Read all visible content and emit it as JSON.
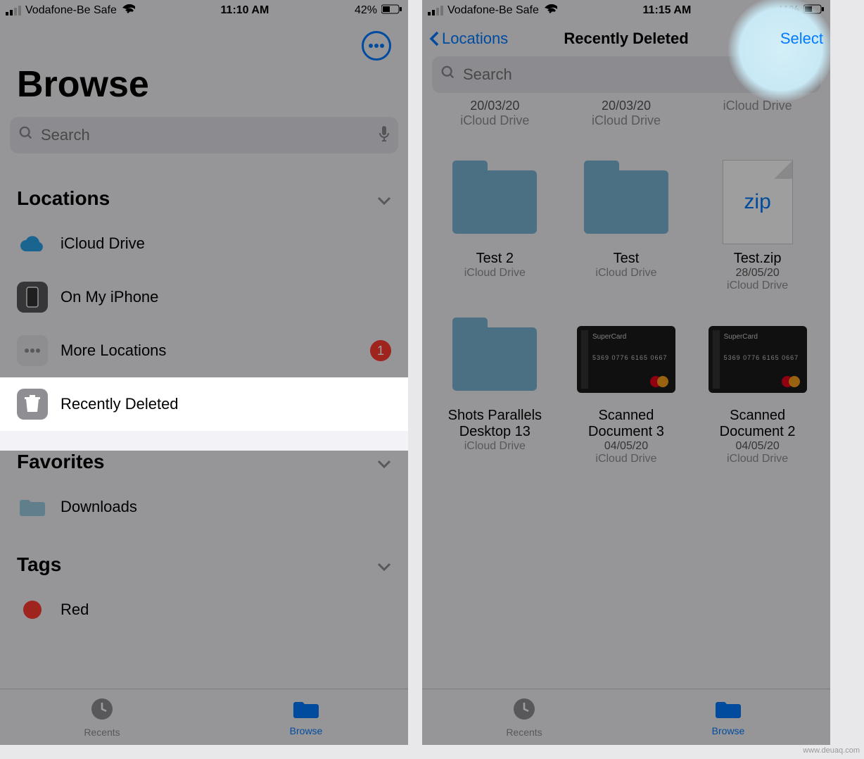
{
  "watermark": "www.deuaq.com",
  "left": {
    "statusbar": {
      "carrier": "Vodafone-Be Safe",
      "time": "11:10 AM",
      "battery_pct": "42%"
    },
    "large_title": "Browse",
    "search_placeholder": "Search",
    "sections": {
      "locations_header": "Locations",
      "favorites_header": "Favorites",
      "tags_header": "Tags"
    },
    "locations": [
      {
        "id": "icloud",
        "label": "iCloud Drive"
      },
      {
        "id": "onmyiphone",
        "label": "On My iPhone"
      },
      {
        "id": "more",
        "label": "More Locations",
        "badge": "1"
      },
      {
        "id": "recentlydeleted",
        "label": "Recently Deleted"
      }
    ],
    "favorites": [
      {
        "id": "downloads",
        "label": "Downloads"
      }
    ],
    "tags": [
      {
        "id": "red",
        "label": "Red",
        "color": "#ff3b30"
      }
    ],
    "tabs": {
      "recents": "Recents",
      "browse": "Browse"
    }
  },
  "right": {
    "statusbar": {
      "carrier": "Vodafone-Be Safe",
      "time": "11:15 AM",
      "battery_pct": "41%"
    },
    "back_label": "Locations",
    "title": "Recently Deleted",
    "select_label": "Select",
    "search_placeholder": "Search",
    "partial_top": [
      {
        "date": "20/03/20",
        "loc": "iCloud Drive"
      },
      {
        "date": "20/03/20",
        "loc": "iCloud Drive"
      },
      {
        "loc": "iCloud Drive"
      }
    ],
    "items": [
      {
        "kind": "folder",
        "name": "Test 2",
        "loc": "iCloud Drive"
      },
      {
        "kind": "folder",
        "name": "Test",
        "loc": "iCloud Drive"
      },
      {
        "kind": "zip",
        "name": "Test.zip",
        "date": "28/05/20",
        "loc": "iCloud Drive",
        "zip_text": "zip"
      },
      {
        "kind": "folder",
        "name": "Shots Parallels Desktop 13",
        "loc": "iCloud Drive"
      },
      {
        "kind": "card",
        "name": "Scanned Document 3",
        "date": "04/05/20",
        "loc": "iCloud Drive"
      },
      {
        "kind": "card",
        "name": "Scanned Document 2",
        "date": "04/05/20",
        "loc": "iCloud Drive"
      }
    ],
    "tabs": {
      "recents": "Recents",
      "browse": "Browse"
    }
  }
}
